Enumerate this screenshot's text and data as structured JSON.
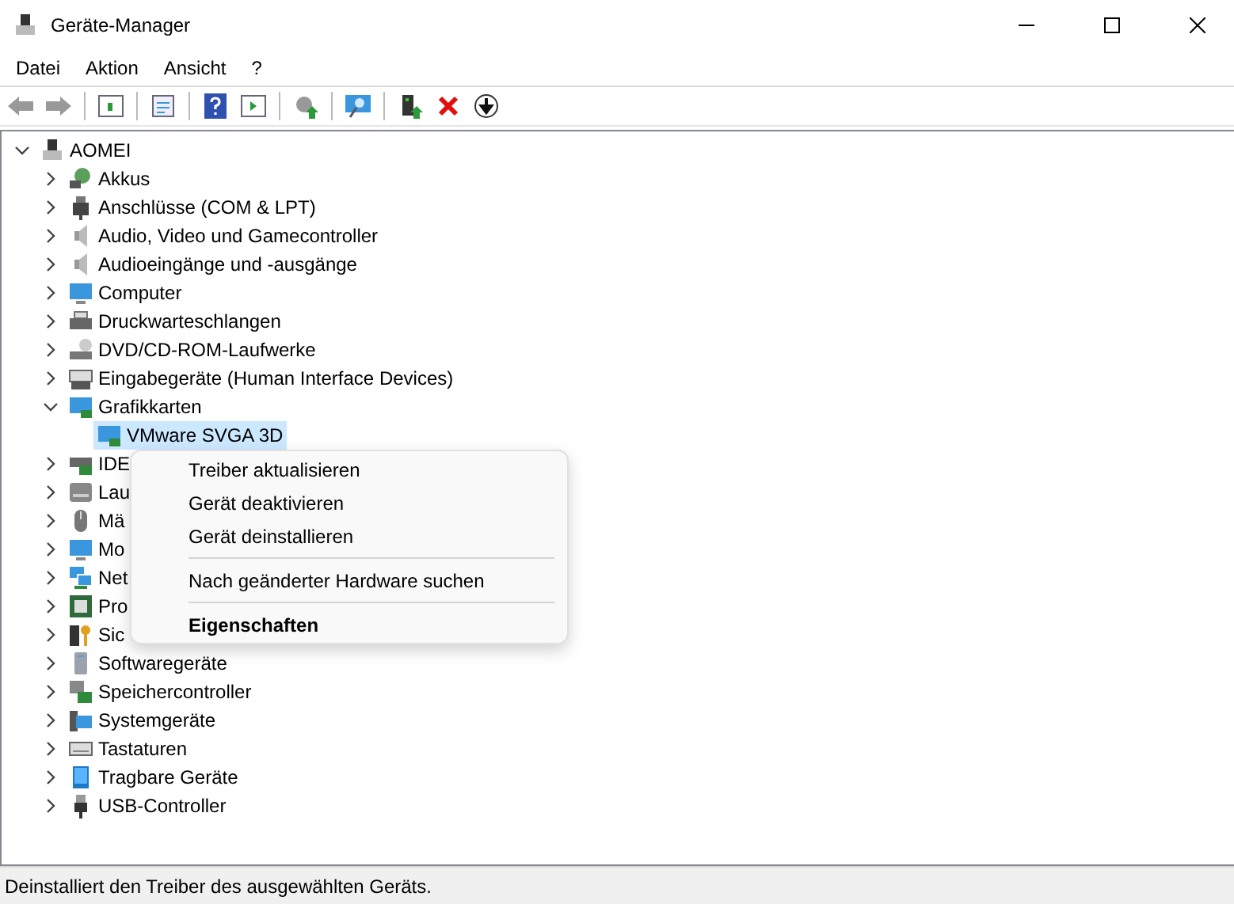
{
  "window": {
    "title": "Geräte-Manager"
  },
  "menu": [
    "Datei",
    "Aktion",
    "Ansicht",
    "?"
  ],
  "tree": {
    "label": "AOMEI",
    "expanded": true,
    "selected": false,
    "children": [
      {
        "label": "Akkus",
        "expanded": false,
        "selected": false
      },
      {
        "label": "Anschlüsse (COM & LPT)",
        "expanded": false,
        "selected": false
      },
      {
        "label": "Audio, Video und Gamecontroller",
        "expanded": false,
        "selected": false
      },
      {
        "label": "Audioeingänge und -ausgänge",
        "expanded": false,
        "selected": false
      },
      {
        "label": "Computer",
        "expanded": false,
        "selected": false
      },
      {
        "label": "Druckwarteschlangen",
        "expanded": false,
        "selected": false
      },
      {
        "label": "DVD/CD-ROM-Laufwerke",
        "expanded": false,
        "selected": false
      },
      {
        "label": "Eingabegeräte (Human Interface Devices)",
        "expanded": false,
        "selected": false
      },
      {
        "label": "Grafikkarten",
        "expanded": true,
        "selected": false,
        "children": [
          {
            "label": "VMware SVGA 3D",
            "selected": true
          }
        ]
      },
      {
        "label": "IDE",
        "expanded": false,
        "selected": false
      },
      {
        "label": "Lau",
        "expanded": false,
        "selected": false
      },
      {
        "label": "Mä",
        "expanded": false,
        "selected": false
      },
      {
        "label": "Mo",
        "expanded": false,
        "selected": false
      },
      {
        "label": "Net",
        "expanded": false,
        "selected": false
      },
      {
        "label": "Pro",
        "expanded": false,
        "selected": false
      },
      {
        "label": "Sic",
        "expanded": false,
        "selected": false
      },
      {
        "label": "Softwaregeräte",
        "expanded": false,
        "selected": false
      },
      {
        "label": "Speichercontroller",
        "expanded": false,
        "selected": false
      },
      {
        "label": "Systemgeräte",
        "expanded": false,
        "selected": false
      },
      {
        "label": "Tastaturen",
        "expanded": false,
        "selected": false
      },
      {
        "label": "Tragbare Geräte",
        "expanded": false,
        "selected": false
      },
      {
        "label": "USB-Controller",
        "expanded": false,
        "selected": false
      }
    ]
  },
  "context_menu": [
    {
      "kind": "item",
      "label": "Treiber aktualisieren",
      "default": false
    },
    {
      "kind": "item",
      "label": "Gerät deaktivieren",
      "default": false
    },
    {
      "kind": "item",
      "label": "Gerät deinstallieren",
      "default": false
    },
    {
      "kind": "separator"
    },
    {
      "kind": "item",
      "label": "Nach geänderter Hardware suchen",
      "default": false
    },
    {
      "kind": "separator"
    },
    {
      "kind": "item",
      "label": "Eigenschaften",
      "default": true
    }
  ],
  "status_bar": "Deinstalliert den Treiber des ausgewählten Geräts."
}
